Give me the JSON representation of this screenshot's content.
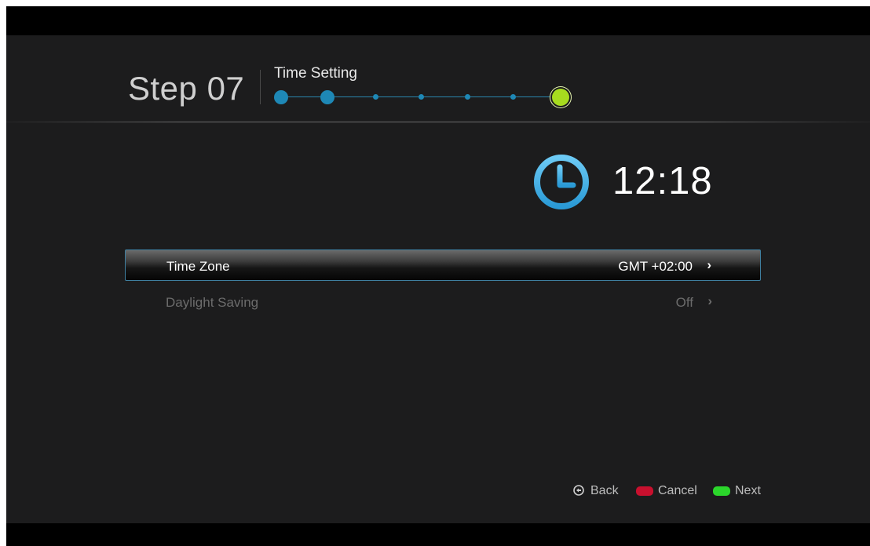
{
  "header": {
    "step_label": "Step 07",
    "title": "Time Setting",
    "progress": {
      "total_steps": 7,
      "current_step": 7
    }
  },
  "clock": {
    "icon": "clock-icon",
    "time": "12:18",
    "color": "#39aee6"
  },
  "menu": {
    "items": [
      {
        "label": "Time Zone",
        "value": "GMT +02:00",
        "selected": true
      },
      {
        "label": "Daylight Saving",
        "value": "Off",
        "selected": false
      }
    ],
    "arrow_glyph": "›"
  },
  "footer": {
    "back": {
      "icon": "back-remote-icon",
      "label": "Back"
    },
    "cancel": {
      "label": "Cancel",
      "color": "#c8102e"
    },
    "next": {
      "label": "Next",
      "color": "#2bd62b"
    }
  },
  "colors": {
    "accent": "#1e88b6",
    "progress_current": "#a7dc1f",
    "background": "#1c1c1d"
  }
}
